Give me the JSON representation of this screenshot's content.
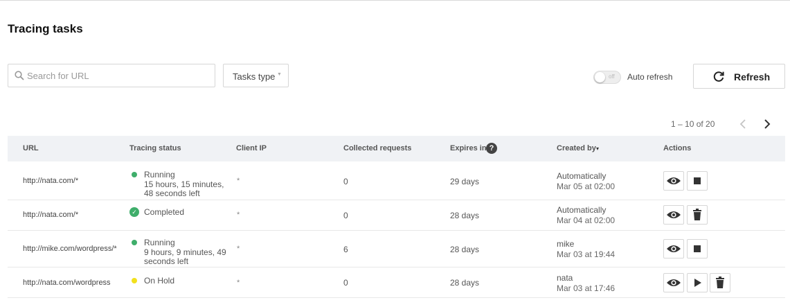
{
  "page": {
    "title": "Tracing tasks"
  },
  "filters": {
    "search_placeholder": "Search for URL",
    "tasks_type_label": "Tasks type"
  },
  "auto_refresh": {
    "label": "Auto refresh",
    "state_label": "off",
    "enabled": false
  },
  "refresh_button": {
    "label": "Refresh"
  },
  "pagination": {
    "range_text": "1 – 10 of 20"
  },
  "table": {
    "columns": {
      "url": "URL",
      "status": "Tracing status",
      "client_ip": "Client IP",
      "requests": "Collected requests",
      "expires": "Expires in",
      "created_by": "Created by",
      "actions": "Actions"
    },
    "help_symbol": "?",
    "sort_symbol": "▾",
    "rows": [
      {
        "url": "http://nata.com/*",
        "status": "Running",
        "status_detail": "15 hours, 15 minutes, 48 seconds left",
        "client_ip": "*",
        "requests": "0",
        "expires": "29 days",
        "created_by": "Automatically",
        "created_at": "Mar 05 at 02:00"
      },
      {
        "url": "http://nata.com/*",
        "status": "Completed",
        "status_detail": "",
        "client_ip": "*",
        "requests": "0",
        "expires": "28 days",
        "created_by": "Automatically",
        "created_at": "Mar 04 at 02:00"
      },
      {
        "url": "http://mike.com/wordpress/*",
        "status": "Running",
        "status_detail": "9 hours, 9 minutes, 49 seconds left",
        "client_ip": "*",
        "requests": "6",
        "expires": "28 days",
        "created_by": "mike",
        "created_at": "Mar 03 at 19:44"
      },
      {
        "url": "http://nata.com/wordpress",
        "status": "On Hold",
        "status_detail": "",
        "client_ip": "*",
        "requests": "0",
        "expires": "28 days",
        "created_by": "nata",
        "created_at": "Mar 03 at 17:46"
      }
    ]
  },
  "colors": {
    "running": "#3fae6b",
    "completed": "#3fae6b",
    "on_hold": "#f2e01d",
    "header_bg": "#f0f2f5"
  },
  "icons": {
    "search": "search-icon",
    "refresh": "refresh-icon",
    "view": "eye-icon",
    "stop": "stop-icon",
    "delete": "trash-icon",
    "resume": "play-icon"
  }
}
